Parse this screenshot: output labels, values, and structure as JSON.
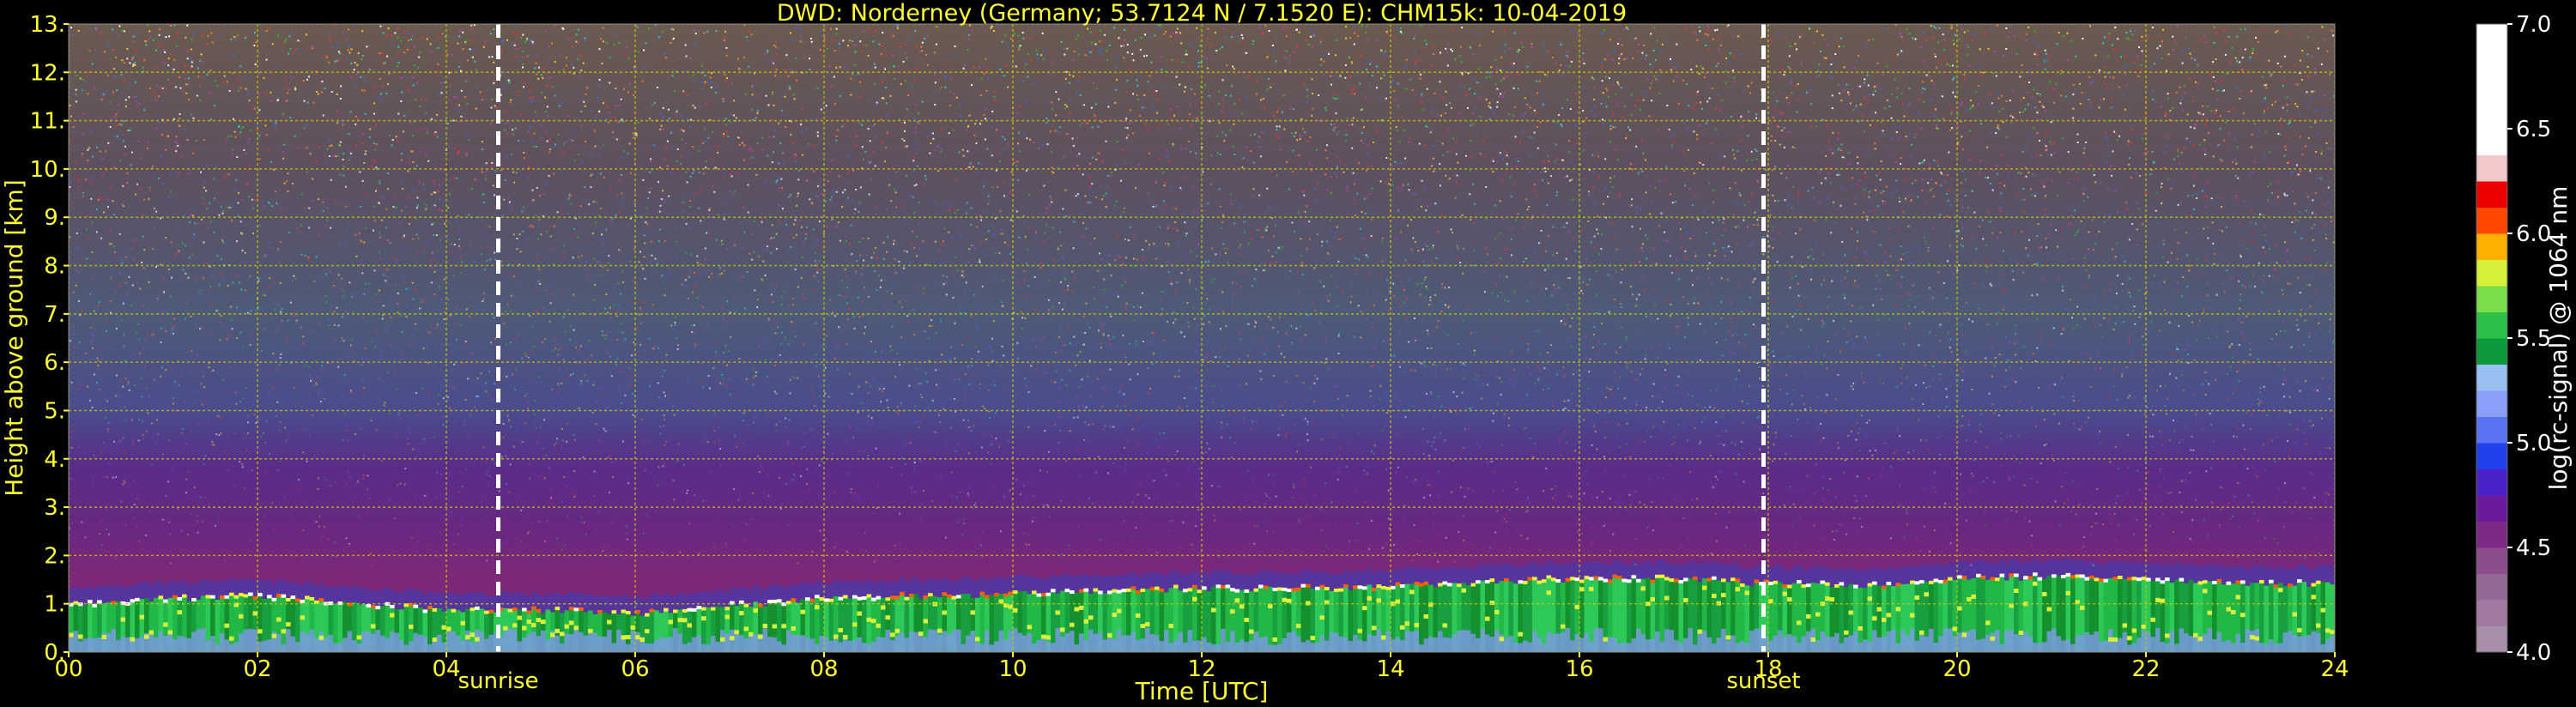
{
  "chart_data": {
    "type": "heatmap",
    "title": "DWD: Norderney (Germany; 53.7124 N / 7.1520 E):    CHM15k: 10-04-2019",
    "xlabel": "Time [UTC]",
    "ylabel": "Height above ground [km]",
    "xlim": [
      0,
      24
    ],
    "ylim": [
      0,
      13
    ],
    "x_ticks": [
      0,
      2,
      4,
      6,
      8,
      10,
      12,
      14,
      16,
      18,
      20,
      22,
      24
    ],
    "x_tick_labels": [
      "00",
      "02",
      "04",
      "06",
      "08",
      "10",
      "12",
      "14",
      "16",
      "18",
      "20",
      "22",
      "24"
    ],
    "y_ticks": [
      0,
      1,
      2,
      3,
      4,
      5,
      6,
      7,
      8,
      9,
      10,
      11,
      12,
      13
    ],
    "y_tick_labels": [
      "0.",
      "1.",
      "2.",
      "3.",
      "4.",
      "5.",
      "6.",
      "7.",
      "8.",
      "9.",
      "10.",
      "11.",
      "12.",
      "13."
    ],
    "grid": true,
    "events": [
      {
        "label": "sunrise",
        "time": 4.55
      },
      {
        "label": "sunset",
        "time": 17.95
      }
    ],
    "boundary_layer_top_km": {
      "time": [
        0,
        1,
        2,
        3,
        4,
        5,
        6,
        7,
        8,
        9,
        10,
        11,
        12,
        13,
        14,
        15,
        16,
        17,
        18,
        19,
        20,
        21,
        22,
        23,
        24
      ],
      "height": [
        0.95,
        1.1,
        1.15,
        1.0,
        0.85,
        0.85,
        0.8,
        0.95,
        1.1,
        1.15,
        1.2,
        1.25,
        1.3,
        1.3,
        1.35,
        1.45,
        1.5,
        1.5,
        1.4,
        1.35,
        1.5,
        1.55,
        1.5,
        1.4,
        1.4
      ]
    },
    "colorbar": {
      "label": "log(rc-signal) @ 1064 nm",
      "range": [
        4.0,
        7.0
      ],
      "ticks": [
        4.0,
        4.5,
        5.0,
        5.5,
        6.0,
        6.5,
        7.0
      ],
      "tick_labels": [
        "4.0",
        "4.5",
        "5.0",
        "5.5",
        "6.0",
        "6.5",
        "7.0"
      ],
      "levels": [
        {
          "from": 4.0,
          "color": "#a890a8"
        },
        {
          "from": 4.125,
          "color": "#a07aa0"
        },
        {
          "from": 4.25,
          "color": "#946894"
        },
        {
          "from": 4.375,
          "color": "#8a4c8a"
        },
        {
          "from": 4.5,
          "color": "#7e2a84"
        },
        {
          "from": 4.625,
          "color": "#6a1a9c"
        },
        {
          "from": 4.75,
          "color": "#4a20c8"
        },
        {
          "from": 4.875,
          "color": "#2040ec"
        },
        {
          "from": 5.0,
          "color": "#5a74f4"
        },
        {
          "from": 5.125,
          "color": "#8aa0f8"
        },
        {
          "from": 5.25,
          "color": "#98c0f0"
        },
        {
          "from": 5.375,
          "color": "#0e9a3a"
        },
        {
          "from": 5.5,
          "color": "#2cc04a"
        },
        {
          "from": 5.625,
          "color": "#7ae04a"
        },
        {
          "from": 5.75,
          "color": "#d8f03a"
        },
        {
          "from": 5.875,
          "color": "#ffb000"
        },
        {
          "from": 6.0,
          "color": "#ff4800"
        },
        {
          "from": 6.125,
          "color": "#ee0000"
        },
        {
          "from": 6.25,
          "color": "#f4c8c8"
        },
        {
          "from": 6.375,
          "color": "#ffffff"
        },
        {
          "from": 7.0,
          "color": "#ffffff"
        }
      ]
    }
  },
  "colors": {
    "background": "#000000",
    "axis_text": "#ffff33",
    "grid": "#c8c800",
    "event_line": "#ffffff",
    "colorbar_text": "#ffffff"
  }
}
